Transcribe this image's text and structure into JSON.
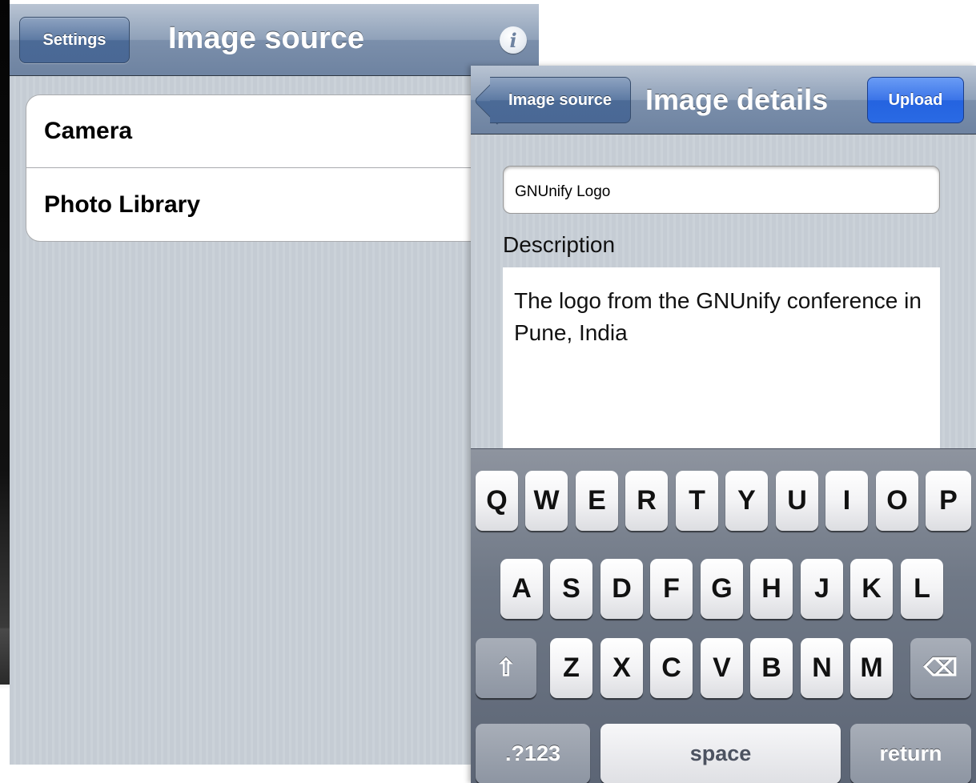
{
  "screen1": {
    "nav": {
      "back_label": "Settings",
      "title": "Image source",
      "info_glyph": "i"
    },
    "cells": [
      {
        "label": "Camera"
      },
      {
        "label": "Photo Library"
      }
    ]
  },
  "screen2": {
    "nav": {
      "back_label": "Image source",
      "title": "Image details",
      "action_label": "Upload"
    },
    "title_field": {
      "value": "GNUnify Logo"
    },
    "description": {
      "label": "Description",
      "value": "The logo from the GNUnify conference in Pune, India"
    }
  },
  "keyboard": {
    "row1": [
      "Q",
      "W",
      "E",
      "R",
      "T",
      "Y",
      "U",
      "I",
      "O",
      "P"
    ],
    "row2": [
      "A",
      "S",
      "D",
      "F",
      "G",
      "H",
      "J",
      "K",
      "L"
    ],
    "row3": [
      "Z",
      "X",
      "C",
      "V",
      "B",
      "N",
      "M"
    ],
    "numbers_label": ".?123",
    "space_label": "space",
    "return_label": "return",
    "shift_glyph": "⇧",
    "delete_glyph": "⌫"
  },
  "colors": {
    "navbar": "#6e83a1",
    "accent_upload": "#2a6ae4",
    "background": "#c5ccd4"
  },
  "icons": [
    "info-icon",
    "back-arrow-icon",
    "shift-icon",
    "delete-icon"
  ]
}
